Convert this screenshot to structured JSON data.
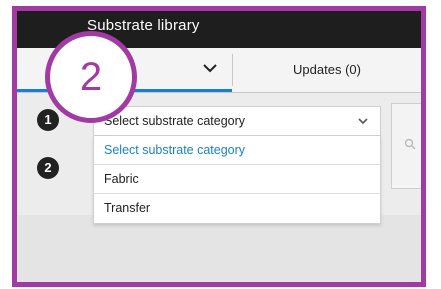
{
  "header": {
    "title": "Substrate library"
  },
  "tabs": {
    "updates_label": "Updates (0)"
  },
  "steps": [
    "1",
    "2"
  ],
  "category_select": {
    "current": "Select substrate category",
    "options": [
      "Select substrate category",
      "Fabric",
      "Transfer"
    ]
  },
  "callout": {
    "number": "2"
  },
  "colors": {
    "accent": "#1a7fd0",
    "callout": "#a23aa4",
    "titlebar": "#1e1e1e"
  },
  "icons": {
    "tab_dropdown": "chevron-down-icon",
    "select_dropdown": "chevron-down-icon",
    "search": "search-icon"
  }
}
